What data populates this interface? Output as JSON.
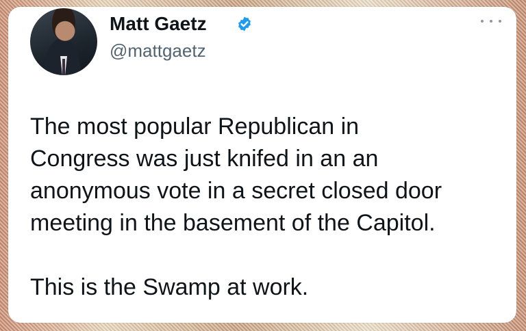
{
  "tweet": {
    "author_name": "Matt Gaetz",
    "handle": "@mattgaetz",
    "verified_icon": "verified-badge-icon",
    "more_icon": "more-options-icon",
    "body_lines": [
      "The most popular Republican in",
      "Congress was just knifed in an an",
      "anonymous vote in a secret closed door",
      "meeting in the basement of the Capitol."
    ],
    "body_paragraph_2": "This is the Swamp at work."
  },
  "colors": {
    "verified": "#1d9bf0",
    "text": "#0f1419",
    "secondary": "#536471"
  }
}
